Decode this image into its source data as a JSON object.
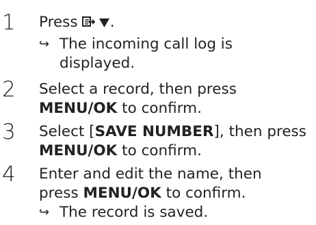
{
  "steps": [
    {
      "number": "1",
      "text_before": "Press",
      "icon_1": "call-log-icon",
      "icon_2": "down-arrow-icon",
      "text_after": ".",
      "result_arrow": "↪",
      "result_line1": "The incoming call log is",
      "result_line2": "displayed."
    },
    {
      "number": "2",
      "line1": "Select a record, then press",
      "key": "MENU/OK",
      "line2_after": " to confirm."
    },
    {
      "number": "3",
      "line1_before": "Select ",
      "line1_bracket_open": "[",
      "option": "SAVE NUMBER",
      "line1_bracket_close": "]",
      "line1_after": ", then press",
      "key": "MENU/OK",
      "line2_after": " to confirm."
    },
    {
      "number": "4",
      "line1": "Enter and edit the name, then",
      "line2_before": "press ",
      "key": "MENU/OK",
      "line2_after": " to confirm.",
      "result_arrow": "↪",
      "result_line1": "The record is saved."
    }
  ]
}
